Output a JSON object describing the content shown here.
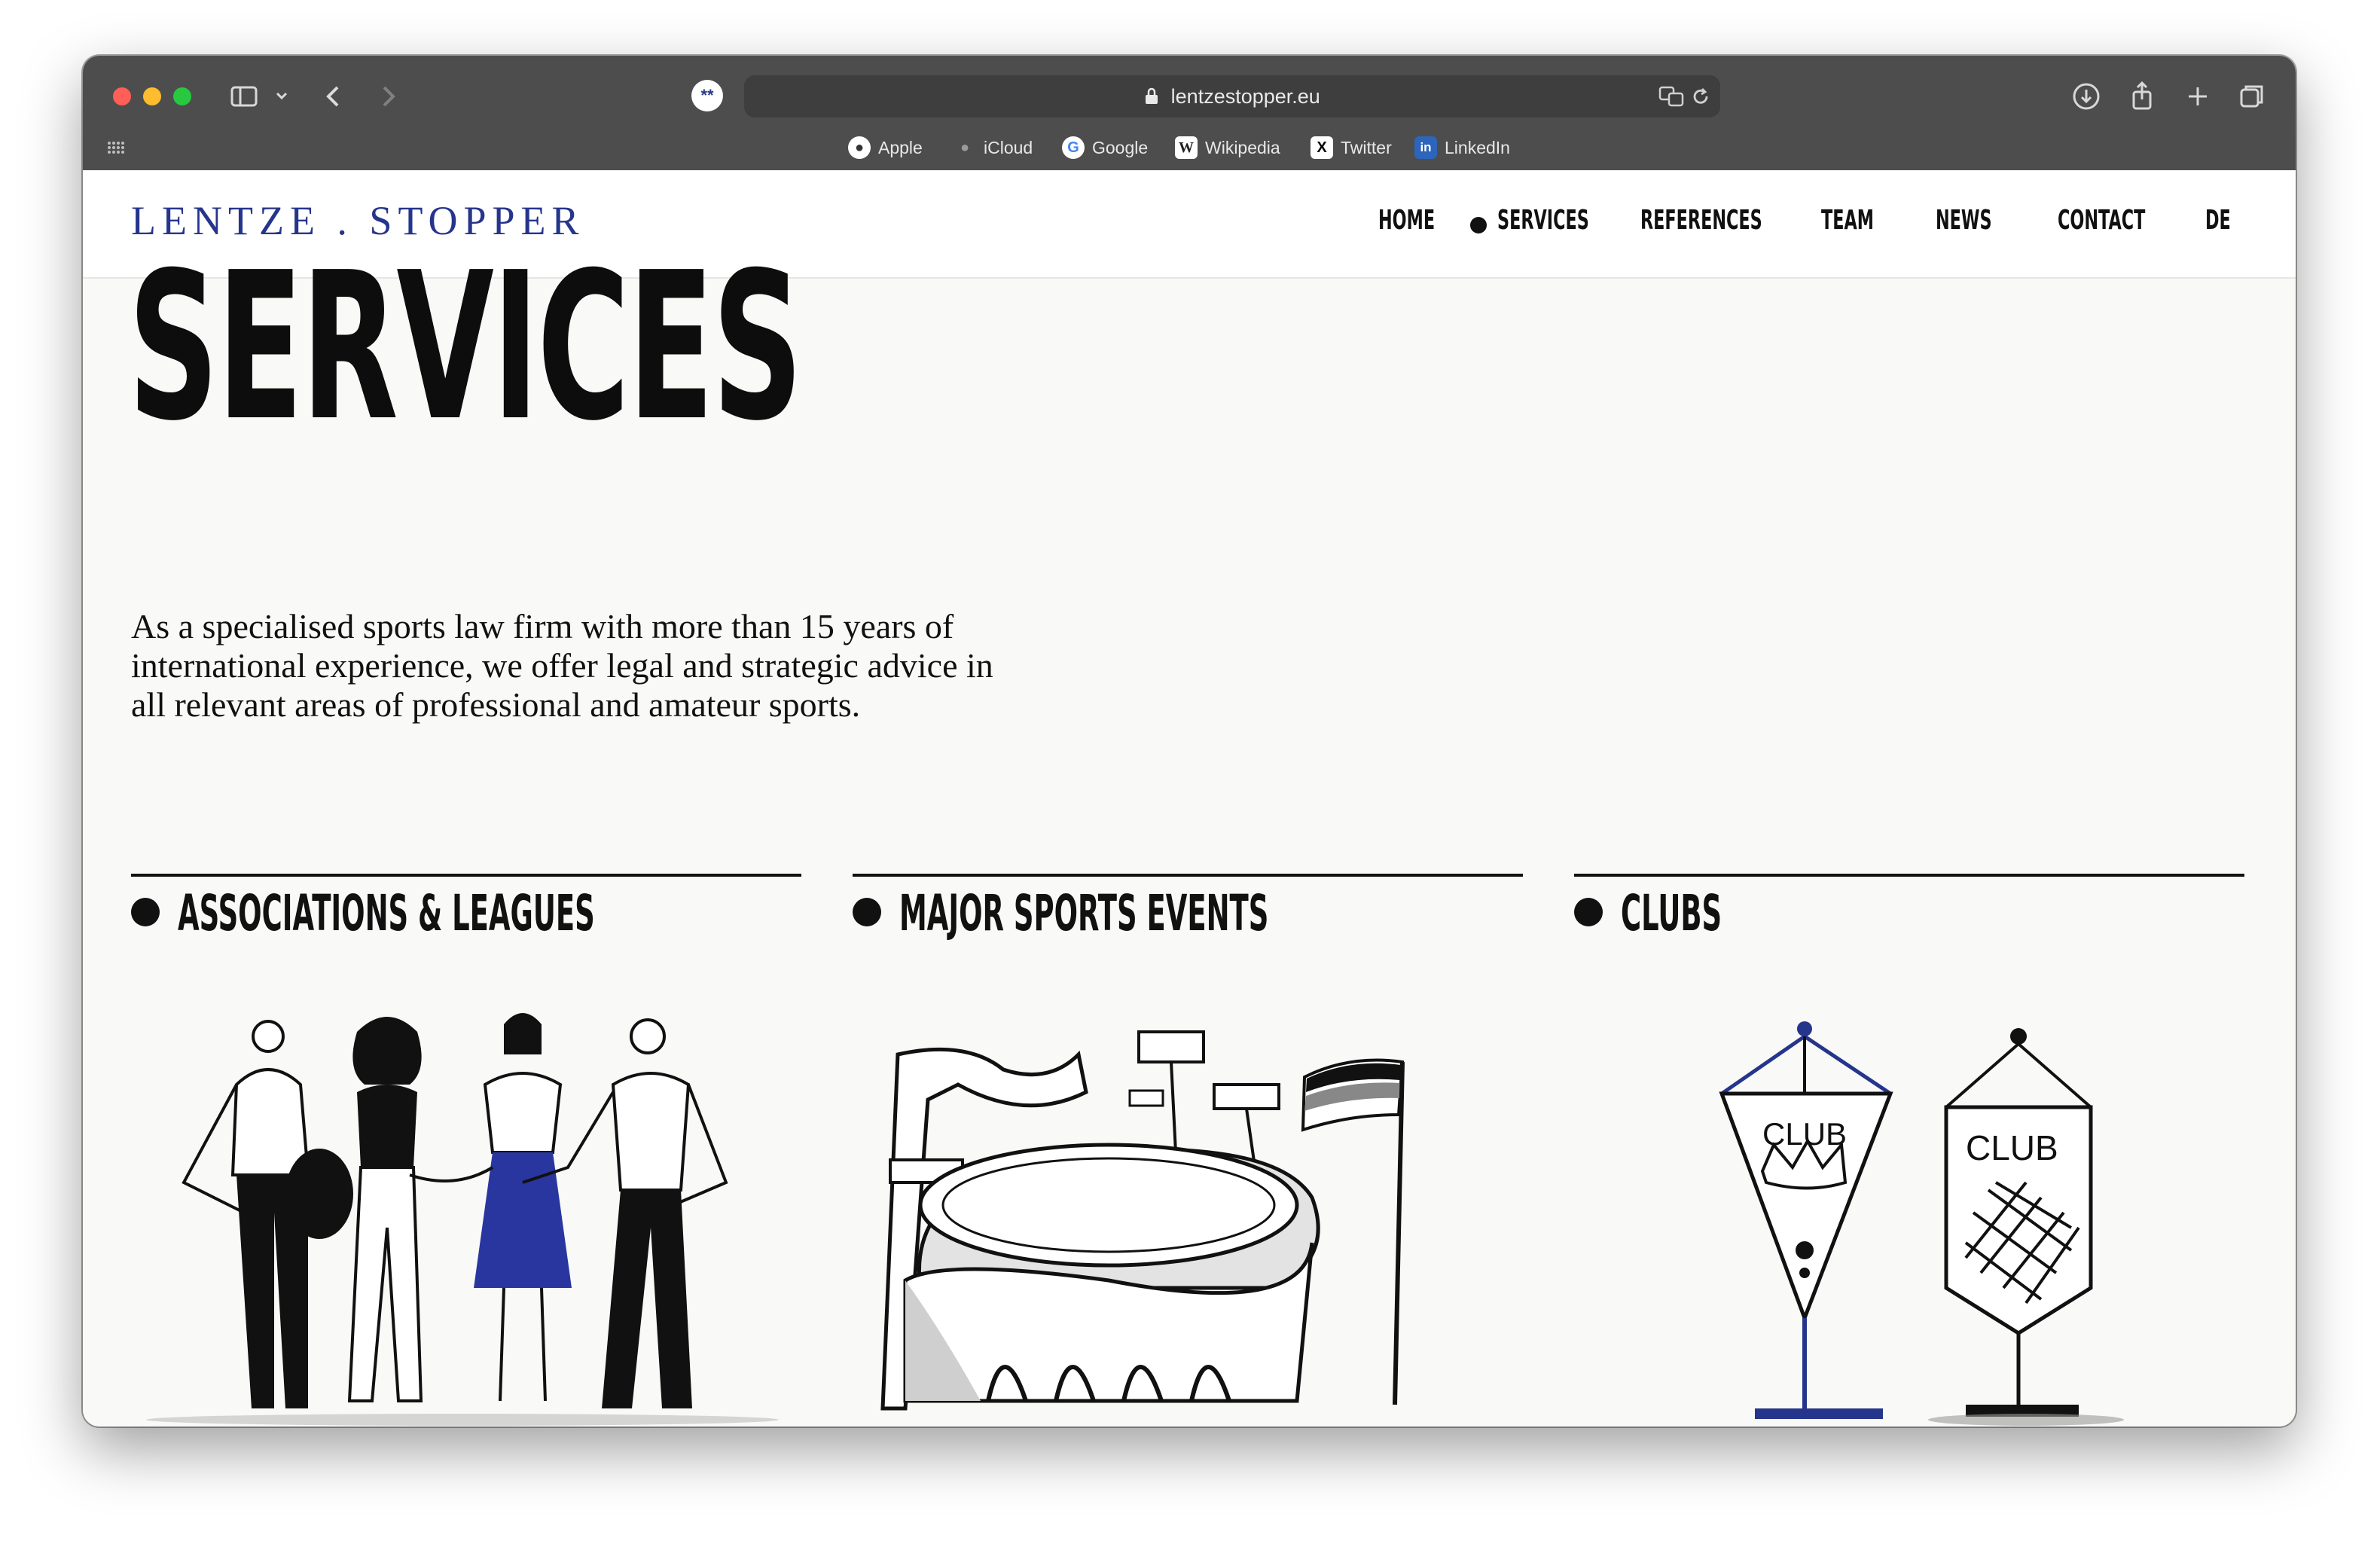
{
  "browser": {
    "url": "lentzestopper.eu",
    "bookmarks": [
      "Apple",
      "iCloud",
      "Google",
      "Wikipedia",
      "Twitter",
      "LinkedIn"
    ]
  },
  "site": {
    "logo": "LENTZE . STOPPER",
    "nav": {
      "home": "HOME",
      "services": "SERVICES",
      "references": "REFERENCES",
      "team": "TEAM",
      "news": "NEWS",
      "contact": "CONTACT",
      "lang": "DE"
    },
    "active_nav": "services"
  },
  "main": {
    "title": "SERVICES",
    "intro_lines": [
      "As a specialised sports law firm with more than 15 years of",
      "international experience, we offer legal and strategic advice in",
      "all relevant areas of professional and amateur sports."
    ],
    "cards": [
      {
        "title": "ASSOCIATIONS & LEAGUES",
        "image": "people-group-illustration"
      },
      {
        "title": "MAJOR SPORTS EVENTS",
        "image": "stadium-illustration"
      },
      {
        "title": "CLUBS",
        "image": "club-pennants-illustration"
      }
    ],
    "pennant_texts": [
      "CLUB",
      "CLUB"
    ]
  },
  "colors": {
    "brand_blue": "#26358c",
    "text": "#111111",
    "page_bg": "#f9f9f7"
  }
}
